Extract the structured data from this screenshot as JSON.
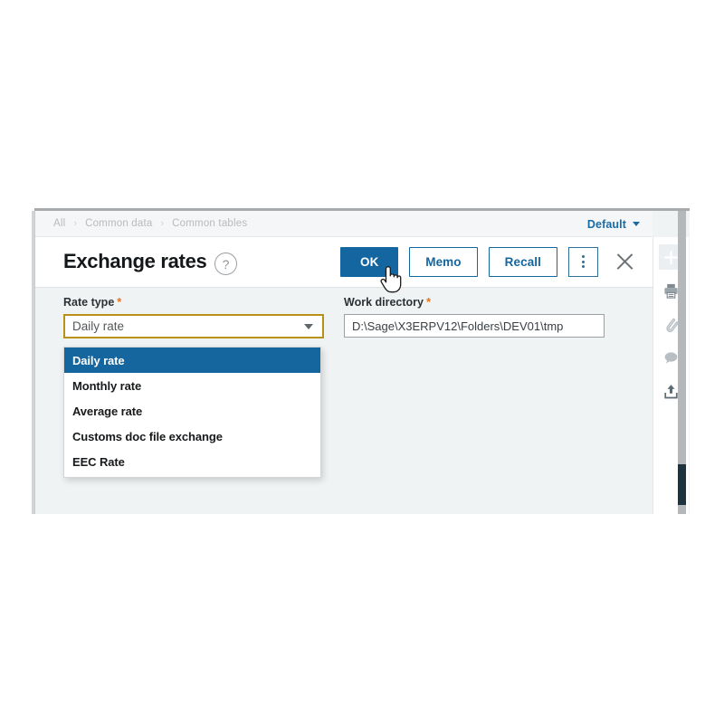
{
  "breadcrumb": {
    "items": [
      "All",
      "Common data",
      "Common tables"
    ],
    "separator": "›"
  },
  "view_selector": {
    "label": "Default",
    "icon": "chevron-down-icon"
  },
  "header": {
    "title": "Exchange rates",
    "help_icon_glyph": "?",
    "actions": {
      "ok_label": "OK",
      "memo_label": "Memo",
      "recall_label": "Recall",
      "more_icon": "kebab-menu-icon",
      "close_icon": "close-icon"
    }
  },
  "form": {
    "rate_type": {
      "label": "Rate type",
      "required_marker": "*",
      "value": "Daily rate",
      "expanded": true,
      "options": [
        "Daily rate",
        "Monthly rate",
        "Average rate",
        "Customs doc file exchange",
        "EEC Rate"
      ],
      "selected_index": 0
    },
    "work_directory": {
      "label": "Work directory",
      "required_marker": "*",
      "value": "D:\\Sage\\X3ERPV12\\Folders\\DEV01\\tmp",
      "placeholder": "Work directory"
    }
  },
  "tool_rail": {
    "items": [
      {
        "name": "add-icon",
        "glyph": "+"
      },
      {
        "name": "print-icon",
        "glyph": "print"
      },
      {
        "name": "attachment-icon",
        "glyph": "clip"
      },
      {
        "name": "comment-icon",
        "glyph": "bubble"
      },
      {
        "name": "export-icon",
        "glyph": "upload"
      }
    ]
  },
  "colors": {
    "primary_blue": "#1466a0",
    "select_highlight": "#15659f",
    "focus_gold": "#b99116",
    "required_orange": "#e8741e",
    "content_bg": "#f0f3f4",
    "scrollbar_thumb": "#1d333f"
  }
}
